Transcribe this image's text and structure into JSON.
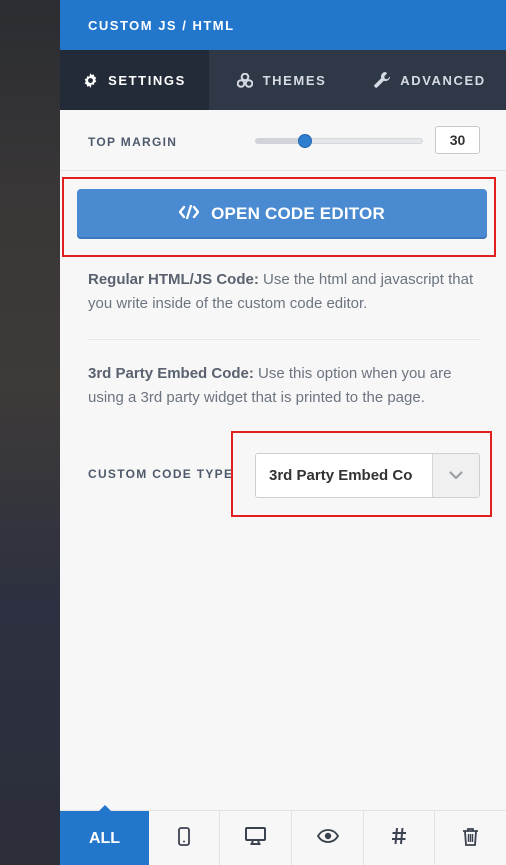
{
  "header": {
    "title": "CUSTOM JS / HTML"
  },
  "tabs": [
    {
      "label": "SETTINGS",
      "icon": "gear-icon",
      "active": true
    },
    {
      "label": "THEMES",
      "icon": "palette-icon",
      "active": false
    },
    {
      "label": "ADVANCED",
      "icon": "wrench-icon",
      "active": false
    }
  ],
  "top_margin": {
    "label": "TOP MARGIN",
    "value": "30",
    "slider_fraction": 0.3
  },
  "code_button": {
    "label": "OPEN CODE EDITOR",
    "icon": "code-icon"
  },
  "descriptions": {
    "regular_bold": "Regular HTML/JS Code:",
    "regular_text": " Use the html and javascript that you write inside of the custom code editor.",
    "third_bold": "3rd Party Embed Code:",
    "third_text": " Use this option when you are using a 3rd party widget that is printed to the page."
  },
  "custom_code_type": {
    "label": "CUSTOM CODE TYPE",
    "selected": "3rd Party Embed Co"
  },
  "bottom_bar": {
    "all_label": "ALL",
    "icons": [
      "mobile-icon",
      "desktop-icon",
      "eye-icon",
      "hash-icon",
      "trash-icon"
    ]
  },
  "colors": {
    "header_blue": "#2277cc",
    "tab_bar": "#2f3847",
    "button_blue": "#4a8ad0",
    "highlight_red": "#e21f1f"
  }
}
